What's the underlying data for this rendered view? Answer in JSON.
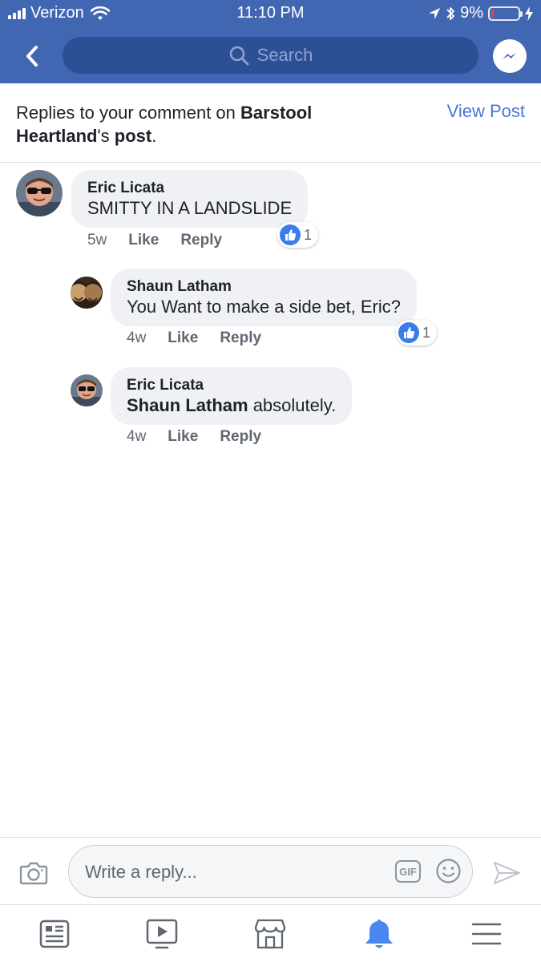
{
  "status_bar": {
    "carrier": "Verizon",
    "time": "11:10 PM",
    "battery": "9%",
    "battery_level": 0.09
  },
  "nav": {
    "search_placeholder": "Search",
    "icons": [
      "back-icon",
      "search-icon",
      "messenger-icon"
    ]
  },
  "banner": {
    "text_prefix": "Replies to your comment on ",
    "page_name": "Barstool Heartland",
    "text_middle": "'s ",
    "text_post": "post",
    "text_end": ".",
    "view_post": "View Post"
  },
  "comments": [
    {
      "author": "Eric Licata",
      "mention": "",
      "text": "SMITTY IN A LANDSLIDE",
      "age": "5w",
      "like": "Like",
      "reply": "Reply",
      "reaction_count": "1"
    },
    {
      "author": "Shaun Latham",
      "mention": "",
      "text": "You Want to make a side bet, Eric?",
      "age": "4w",
      "like": "Like",
      "reply": "Reply",
      "reaction_count": "1"
    },
    {
      "author": "Eric Licata",
      "mention": "Shaun Latham",
      "text": " absolutely.",
      "age": "4w",
      "like": "Like",
      "reply": "Reply",
      "reaction_count": ""
    }
  ],
  "composer": {
    "placeholder": "Write a reply...",
    "gif_label": "GIF"
  },
  "tabs": [
    "news-feed-icon",
    "watch-icon",
    "marketplace-icon",
    "notifications-icon",
    "menu-icon"
  ],
  "colors": {
    "brand_blue": "#4267b2",
    "link_blue": "#4a76d4",
    "active_tab": "#4a87f0",
    "like_blue": "#3b7ce8",
    "bubble_gray": "#f0f1f4"
  }
}
